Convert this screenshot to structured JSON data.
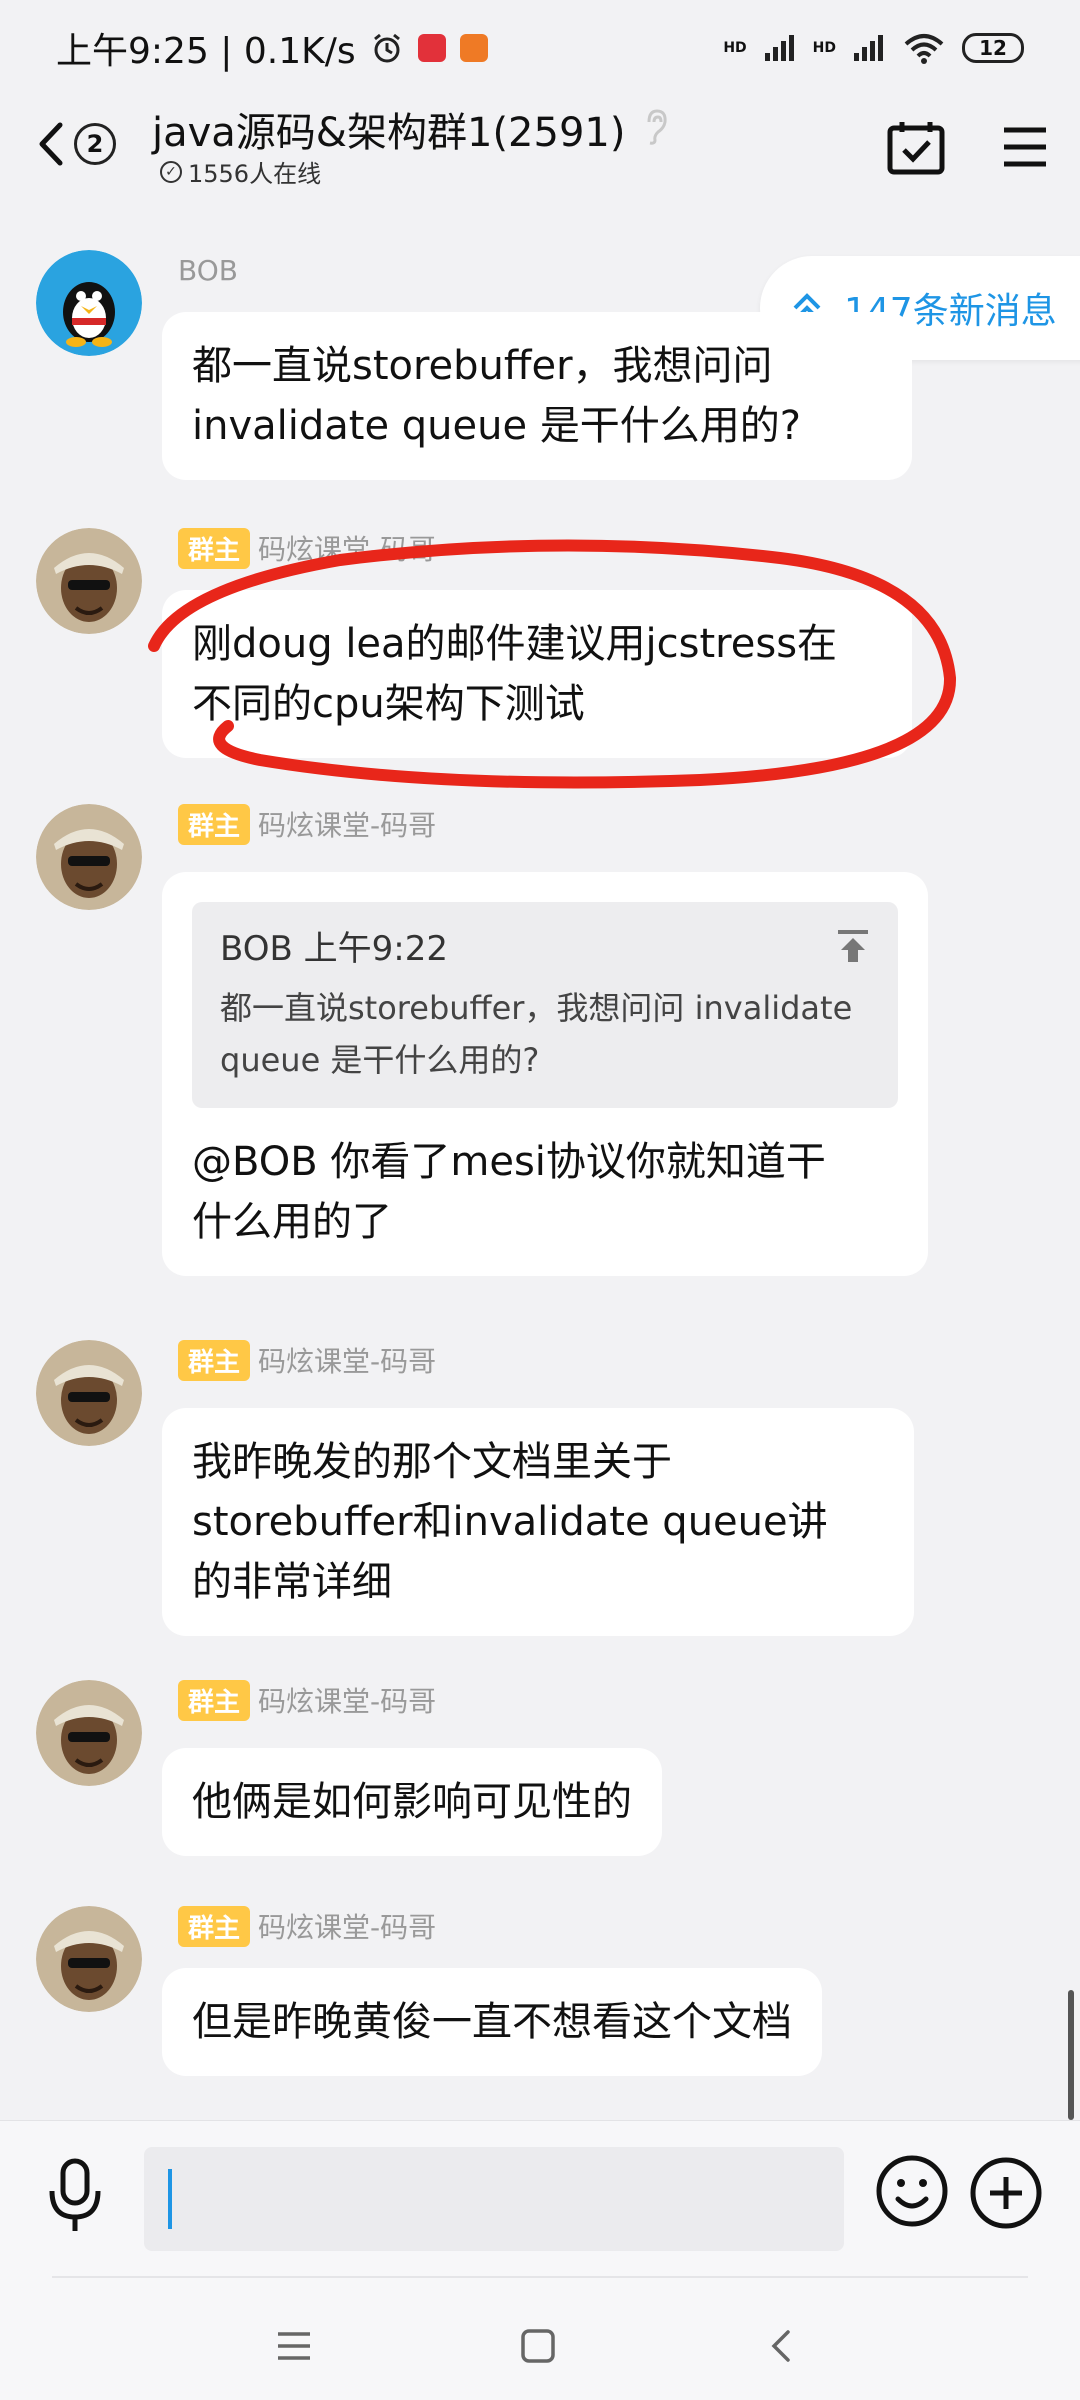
{
  "status_bar": {
    "time_speed": "上午9:25 | 0.1K/s",
    "hd1": "HD",
    "hd2": "HD",
    "battery": "12"
  },
  "header": {
    "back_badge": "2",
    "title": "java源码&架构群1(2591)",
    "online": "1556人在线"
  },
  "new_messages": "147条新消息",
  "messages": [
    {
      "sender": "BOB",
      "is_owner": false,
      "text_lines": [
        "都一直说storebuffer，我想问问",
        "invalidate queue 是干什么用的?"
      ]
    },
    {
      "sender": "码炫课堂-码哥",
      "owner_tag": "群主",
      "text_lines": [
        "刚doug lea的邮件建议用jcstress在",
        "不同的cpu架构下测试"
      ]
    },
    {
      "sender": "码炫课堂-码哥",
      "owner_tag": "群主",
      "quote": {
        "head": "BOB 上午9:22",
        "body_lines": [
          "都一直说storebuffer，我想问问 invalidate",
          "queue 是干什么用的?"
        ]
      },
      "text_lines": [
        "@BOB 你看了mesi协议你就知道干",
        "什么用的了"
      ]
    },
    {
      "sender": "码炫课堂-码哥",
      "owner_tag": "群主",
      "text_lines": [
        "我昨晚发的那个文档里关于",
        "storebuffer和invalidate queue讲",
        "的非常详细"
      ]
    },
    {
      "sender": "码炫课堂-码哥",
      "owner_tag": "群主",
      "text_lines": [
        "他俩是如何影响可见性的"
      ]
    },
    {
      "sender": "码炫课堂-码哥",
      "owner_tag": "群主",
      "text_lines": [
        "但是昨晚黄俊一直不想看这个文档"
      ]
    }
  ],
  "input": {
    "value": "",
    "placeholder": ""
  },
  "colors": {
    "accent": "#1e95e5",
    "owner_tag": "#ffc846",
    "annotation": "#e8261a"
  }
}
